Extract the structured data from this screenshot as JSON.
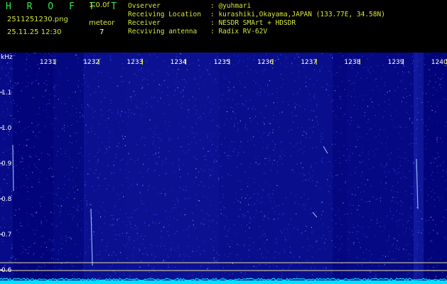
{
  "header": {
    "app_name": "H R O F F T",
    "version": "1.0.0f",
    "filename": "2511251230.png",
    "datetime": "25.11.25 12:30",
    "meteor_label": "meteor",
    "meteor_count": "7",
    "info": [
      {
        "label": "Ovserver",
        "value": ": @yuhmari"
      },
      {
        "label": "Receiving Location",
        "value": ": kurashiki,Okayama,JAPAN (133.77E, 34.58N)"
      },
      {
        "label": "Receiver",
        "value": ": NESDR SMArt + HDSDR"
      },
      {
        "label": "Recviving antenna",
        "value": ": Radix RV-62V"
      }
    ]
  },
  "spectrogram": {
    "y_unit": "kHz",
    "y_ticks": [
      "1.1",
      "1.0",
      "0.9",
      "0.8",
      "0.7",
      "0.6"
    ],
    "time_ticks": [
      "1231",
      "1232",
      "1233",
      "1234",
      "1235",
      "1236",
      "1237",
      "1238",
      "1239",
      "1240"
    ],
    "colors": {
      "background": "#02047a",
      "noise": "#3b50ff",
      "noise_bright": "#9ec4ff",
      "baseline": "#00e0ff",
      "tick_label": "#ffffff",
      "time_tick": "#ffff00",
      "ref_line": "#e8e2a0"
    }
  }
}
